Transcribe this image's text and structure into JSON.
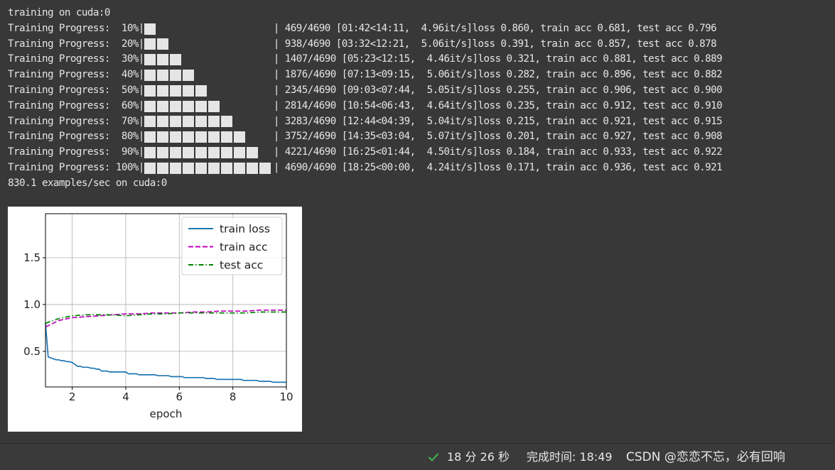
{
  "terminal": {
    "header_line": "training on cuda:0",
    "progress_lines": [
      {
        "prefix": "Training Progress:  10%|",
        "fraction": 0.1,
        "suffix": "| 469/4690 [01:42<14:11,  4.96it/s]loss 0.860, train acc 0.681, test acc 0.796"
      },
      {
        "prefix": "Training Progress:  20%|",
        "fraction": 0.2,
        "suffix": "| 938/4690 [03:32<12:21,  5.06it/s]loss 0.391, train acc 0.857, test acc 0.878"
      },
      {
        "prefix": "Training Progress:  30%|",
        "fraction": 0.3,
        "suffix": "| 1407/4690 [05:23<12:15,  4.46it/s]loss 0.321, train acc 0.881, test acc 0.889"
      },
      {
        "prefix": "Training Progress:  40%|",
        "fraction": 0.4,
        "suffix": "| 1876/4690 [07:13<09:15,  5.06it/s]loss 0.282, train acc 0.896, test acc 0.882"
      },
      {
        "prefix": "Training Progress:  50%|",
        "fraction": 0.5,
        "suffix": "| 2345/4690 [09:03<07:44,  5.05it/s]loss 0.255, train acc 0.906, test acc 0.900"
      },
      {
        "prefix": "Training Progress:  60%|",
        "fraction": 0.6,
        "suffix": "| 2814/4690 [10:54<06:43,  4.64it/s]loss 0.235, train acc 0.912, test acc 0.910"
      },
      {
        "prefix": "Training Progress:  70%|",
        "fraction": 0.7,
        "suffix": "| 3283/4690 [12:44<04:39,  5.04it/s]loss 0.215, train acc 0.921, test acc 0.915"
      },
      {
        "prefix": "Training Progress:  80%|",
        "fraction": 0.8,
        "suffix": "| 3752/4690 [14:35<03:04,  5.07it/s]loss 0.201, train acc 0.927, test acc 0.908"
      },
      {
        "prefix": "Training Progress:  90%|",
        "fraction": 0.9,
        "suffix": "| 4221/4690 [16:25<01:44,  4.50it/s]loss 0.184, train acc 0.933, test acc 0.922"
      },
      {
        "prefix": "Training Progress: 100%|",
        "fraction": 1.0,
        "suffix": "| 4690/4690 [18:25<00:00,  4.24it/s]loss 0.171, train acc 0.936, test acc 0.921"
      }
    ],
    "footer_line": "830.1 examples/sec on cuda:0",
    "colors": {
      "background": "#383838",
      "text": "#e6e6e6",
      "bar": "#e5e5e5"
    }
  },
  "status_bar": {
    "elapsed": "18 分 26 秒",
    "finished_label": "完成时间: 18:49",
    "watermark": "CSDN @恋恋不忘，必有回响",
    "check_color": "#3fb950"
  },
  "chart_data": {
    "type": "line",
    "xlabel": "epoch",
    "ylabel": "",
    "xlim": [
      1,
      10
    ],
    "ylim": [
      0.12,
      1.97
    ],
    "xticks": [
      2,
      4,
      6,
      8,
      10
    ],
    "yticks": [
      0.5,
      1.0,
      1.5
    ],
    "ytick_labels": [
      "0.5",
      "1.0",
      "1.5"
    ],
    "grid": true,
    "legend_position": "top-right",
    "series": [
      {
        "name": "train loss",
        "color": "#1f77b4",
        "dash": "solid",
        "x": [
          1.0,
          1.1,
          1.2,
          1.3,
          1.4,
          1.5,
          1.6,
          1.7,
          1.8,
          1.9,
          2.0,
          2.1,
          2.2,
          2.3,
          2.4,
          2.5,
          2.6,
          2.7,
          2.8,
          2.9,
          3.0,
          3.1,
          3.2,
          3.3,
          3.4,
          3.5,
          3.6,
          3.7,
          3.8,
          3.9,
          4.0,
          4.1,
          4.2,
          4.3,
          4.4,
          4.5,
          4.6,
          4.7,
          4.8,
          4.9,
          5.0,
          5.1,
          5.2,
          5.3,
          5.4,
          5.5,
          5.6,
          5.7,
          5.8,
          5.9,
          6.0,
          6.1,
          6.2,
          6.3,
          6.4,
          6.5,
          6.6,
          6.7,
          6.8,
          6.9,
          7.0,
          7.1,
          7.2,
          7.3,
          7.4,
          7.5,
          7.6,
          7.7,
          7.8,
          7.9,
          8.0,
          8.1,
          8.2,
          8.3,
          8.4,
          8.5,
          8.6,
          8.7,
          8.8,
          8.9,
          9.0,
          9.1,
          9.2,
          9.3,
          9.4,
          9.5,
          9.6,
          9.7,
          9.8,
          9.9,
          10.0
        ],
        "values": [
          0.8,
          0.44,
          0.43,
          0.42,
          0.41,
          0.41,
          0.4,
          0.4,
          0.39,
          0.39,
          0.38,
          0.36,
          0.34,
          0.34,
          0.33,
          0.33,
          0.33,
          0.32,
          0.32,
          0.31,
          0.31,
          0.29,
          0.29,
          0.29,
          0.28,
          0.28,
          0.28,
          0.28,
          0.28,
          0.28,
          0.28,
          0.26,
          0.26,
          0.26,
          0.26,
          0.25,
          0.25,
          0.25,
          0.25,
          0.25,
          0.25,
          0.25,
          0.24,
          0.24,
          0.24,
          0.24,
          0.24,
          0.23,
          0.23,
          0.23,
          0.23,
          0.23,
          0.22,
          0.22,
          0.22,
          0.22,
          0.22,
          0.22,
          0.22,
          0.22,
          0.21,
          0.21,
          0.21,
          0.21,
          0.2,
          0.2,
          0.2,
          0.2,
          0.2,
          0.2,
          0.2,
          0.2,
          0.2,
          0.2,
          0.19,
          0.19,
          0.19,
          0.19,
          0.19,
          0.19,
          0.18,
          0.18,
          0.18,
          0.18,
          0.18,
          0.17,
          0.17,
          0.17,
          0.17,
          0.17,
          0.17
        ]
      },
      {
        "name": "train acc",
        "color": "#bf00bf",
        "dash": "dashed",
        "x": [
          1.0,
          1.5,
          2.0,
          2.5,
          3.0,
          3.5,
          4.0,
          4.5,
          5.0,
          5.5,
          6.0,
          6.5,
          7.0,
          7.5,
          8.0,
          8.5,
          9.0,
          9.5,
          10.0
        ],
        "values": [
          0.76,
          0.83,
          0.86,
          0.87,
          0.88,
          0.89,
          0.9,
          0.9,
          0.91,
          0.91,
          0.91,
          0.92,
          0.92,
          0.93,
          0.93,
          0.93,
          0.94,
          0.94,
          0.94
        ]
      },
      {
        "name": "test acc",
        "color": "#008000",
        "dash": "dashdot",
        "x": [
          1.0,
          1.5,
          2.0,
          2.5,
          3.0,
          3.5,
          4.0,
          4.5,
          5.0,
          5.5,
          6.0,
          6.5,
          7.0,
          7.5,
          8.0,
          8.5,
          9.0,
          9.5,
          10.0
        ],
        "values": [
          0.8,
          0.85,
          0.88,
          0.89,
          0.89,
          0.89,
          0.88,
          0.89,
          0.9,
          0.9,
          0.91,
          0.91,
          0.91,
          0.91,
          0.91,
          0.91,
          0.92,
          0.92,
          0.92
        ]
      }
    ]
  }
}
